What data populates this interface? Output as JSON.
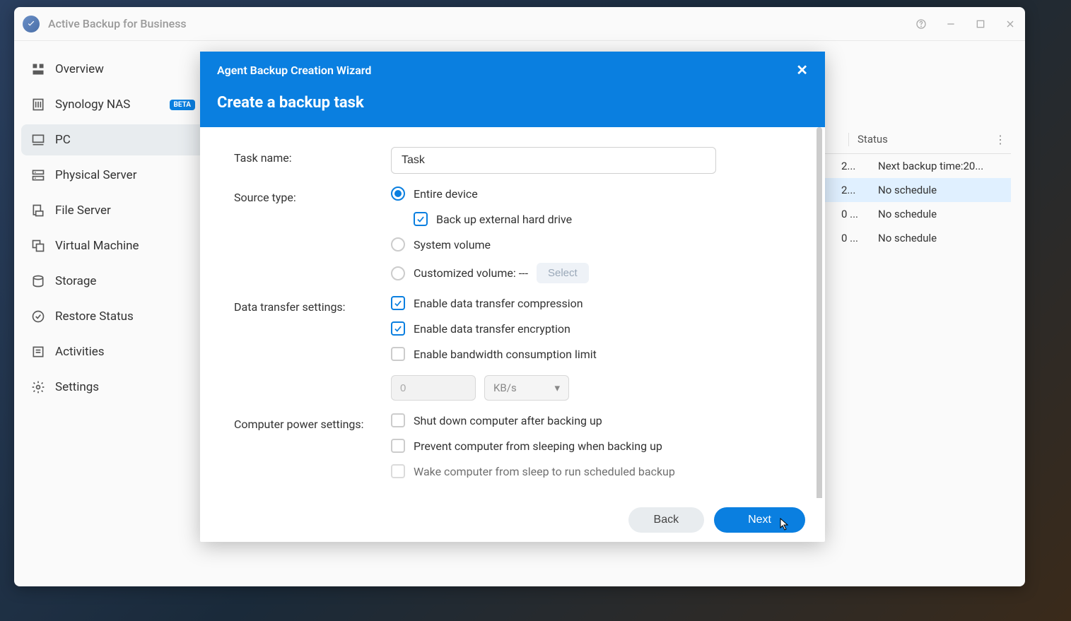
{
  "app": {
    "title": "Active Backup for Business"
  },
  "sidebar": {
    "items": [
      {
        "label": "Overview"
      },
      {
        "label": "Synology NAS",
        "badge": "BETA"
      },
      {
        "label": "PC"
      },
      {
        "label": "Physical Server"
      },
      {
        "label": "File Server"
      },
      {
        "label": "Virtual Machine"
      },
      {
        "label": "Storage"
      },
      {
        "label": "Restore Status"
      },
      {
        "label": "Activities"
      },
      {
        "label": "Settings"
      }
    ]
  },
  "table": {
    "status_header": "Status",
    "rows": [
      {
        "time": "2...",
        "status": "Next backup time:20..."
      },
      {
        "time": "2...",
        "status": "No schedule"
      },
      {
        "time": "0 ...",
        "status": "No schedule"
      },
      {
        "time": "0 ...",
        "status": "No schedule"
      }
    ]
  },
  "modal": {
    "title": "Agent Backup Creation Wizard",
    "subtitle": "Create a backup task",
    "labels": {
      "task_name": "Task name:",
      "source_type": "Source type:",
      "data_transfer": "Data transfer settings:",
      "power": "Computer power settings:"
    },
    "task_name_value": "Task",
    "source": {
      "entire": "Entire device",
      "external": "Back up external hard drive",
      "system": "System volume",
      "custom": "Customized volume: ---",
      "select_btn": "Select"
    },
    "transfer": {
      "compression": "Enable data transfer compression",
      "encryption": "Enable data transfer encryption",
      "bandwidth": "Enable bandwidth consumption limit",
      "bandwidth_value": "0",
      "bandwidth_unit": "KB/s"
    },
    "power": {
      "shutdown": "Shut down computer after backing up",
      "prevent_sleep": "Prevent computer from sleeping when backing up",
      "wake": "Wake computer from sleep to run scheduled backup"
    },
    "buttons": {
      "back": "Back",
      "next": "Next"
    }
  }
}
